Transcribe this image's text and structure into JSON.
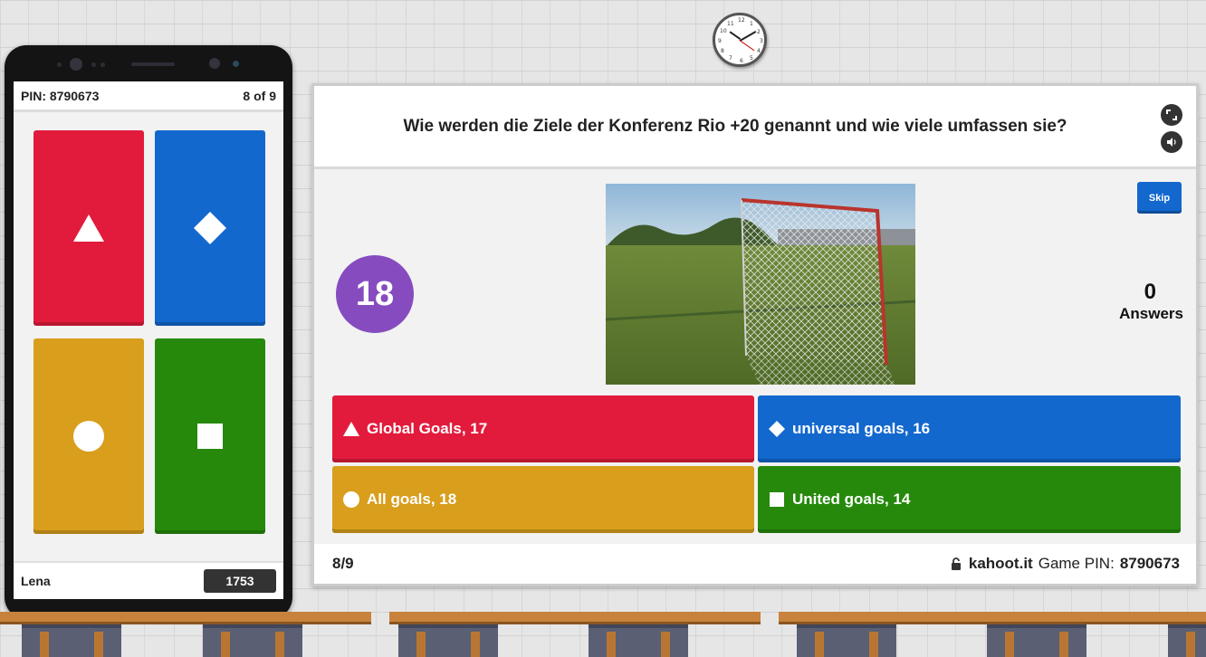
{
  "phone": {
    "pin_label": "PIN: 8790673",
    "progress": "8 of 9",
    "tiles": [
      {
        "shape": "triangle-icon",
        "color": "#e21b3c"
      },
      {
        "shape": "diamond-icon",
        "color": "#1368ce"
      },
      {
        "shape": "circle-icon",
        "color": "#d89e1c"
      },
      {
        "shape": "square-icon",
        "color": "#26890c"
      }
    ],
    "player_name": "Lena",
    "player_score": "1753"
  },
  "board": {
    "question": "Wie werden die Ziele der Konferenz Rio +20 genannt und wie viele umfassen sie?",
    "timer": "18",
    "skip_label": "Skip",
    "answer_count": "0",
    "answer_count_label": "Answers",
    "answers": [
      {
        "text": "Global Goals, 17",
        "icon": "triangle-icon",
        "color": "#e21b3c"
      },
      {
        "text": "universal goals, 16",
        "icon": "diamond-icon",
        "color": "#1368ce"
      },
      {
        "text": "All goals, 18",
        "icon": "circle-icon",
        "color": "#d89e1c"
      },
      {
        "text": "United goals, 14",
        "icon": "square-icon",
        "color": "#26890c"
      }
    ],
    "footer": {
      "progress": "8/9",
      "site": "kahoot.it",
      "pin_label": "Game PIN:",
      "pin": "8790673"
    }
  },
  "clock_numbers": [
    "12",
    "1",
    "2",
    "3",
    "4",
    "5",
    "6",
    "7",
    "8",
    "9",
    "10",
    "11"
  ]
}
